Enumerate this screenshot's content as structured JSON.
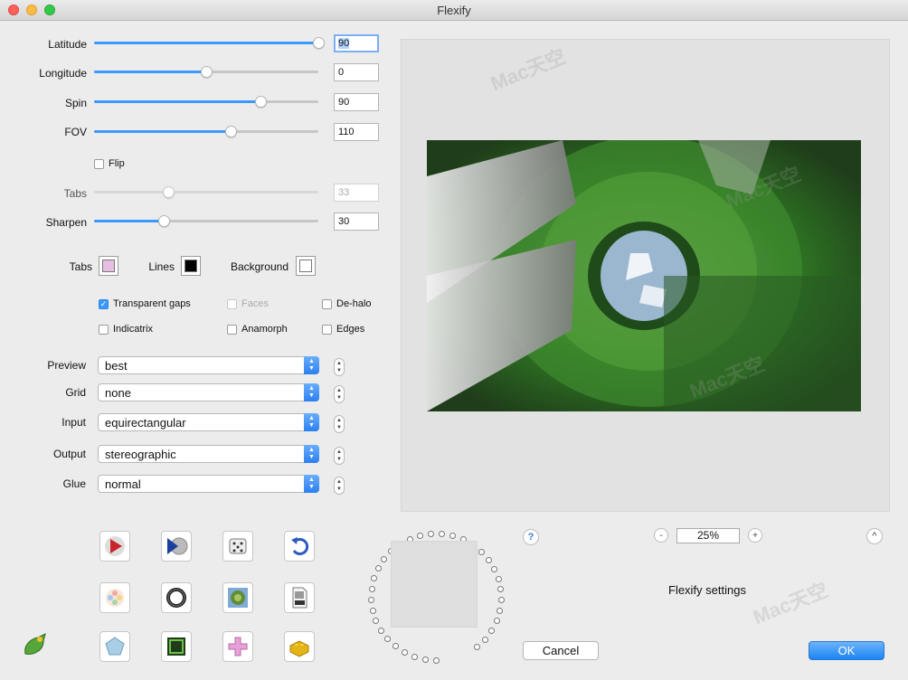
{
  "window": {
    "title": "Flexify"
  },
  "sliders": {
    "latitude": {
      "label": "Latitude",
      "value": "90",
      "fraction": 1.0
    },
    "longitude": {
      "label": "Longitude",
      "value": "0",
      "fraction": 0.5
    },
    "spin": {
      "label": "Spin",
      "value": "90",
      "fraction": 0.74
    },
    "fov": {
      "label": "FOV",
      "value": "110",
      "fraction": 0.61
    },
    "tabs": {
      "label": "Tabs",
      "value": "33",
      "fraction": 0.33,
      "disabled": true
    },
    "sharpen": {
      "label": "Sharpen",
      "value": "30",
      "fraction": 0.31
    }
  },
  "flip": {
    "label": "Flip",
    "checked": false
  },
  "colors": {
    "tabs": {
      "label": "Tabs",
      "color": "#e6bfe3"
    },
    "lines": {
      "label": "Lines",
      "color": "#000000"
    },
    "background": {
      "label": "Background",
      "color": "#ffffff"
    },
    "accent": "#3b99fc"
  },
  "checkboxes": {
    "transparent_gaps": {
      "label": "Transparent gaps",
      "checked": true
    },
    "faces": {
      "label": "Faces",
      "checked": false,
      "disabled": true
    },
    "de_halo": {
      "label": "De-halo",
      "checked": false
    },
    "indicatrix": {
      "label": "Indicatrix",
      "checked": false
    },
    "anamorph": {
      "label": "Anamorph",
      "checked": false
    },
    "edges": {
      "label": "Edges",
      "checked": false
    }
  },
  "popups": {
    "preview": {
      "label": "Preview",
      "value": "best"
    },
    "grid": {
      "label": "Grid",
      "value": "none"
    },
    "input": {
      "label": "Input",
      "value": "equirectangular"
    },
    "output": {
      "label": "Output",
      "value": "stereographic"
    },
    "glue": {
      "label": "Glue",
      "value": "normal"
    }
  },
  "icons": [
    "play-red-icon",
    "play-disc-icon",
    "dice-icon",
    "undo-icon",
    "flower-icon",
    "ring-icon",
    "little-planet-icon",
    "psd-file-icon",
    "gem-icon",
    "frame-icon",
    "pink-cross-icon",
    "lego-brick-icon"
  ],
  "zoom": {
    "value": "25%",
    "minus": "-",
    "plus": "+"
  },
  "help": "?",
  "collapse": "^",
  "settings_label": "Flexify settings",
  "buttons": {
    "cancel": "Cancel",
    "ok": "OK"
  },
  "watermark": "Mac天空"
}
